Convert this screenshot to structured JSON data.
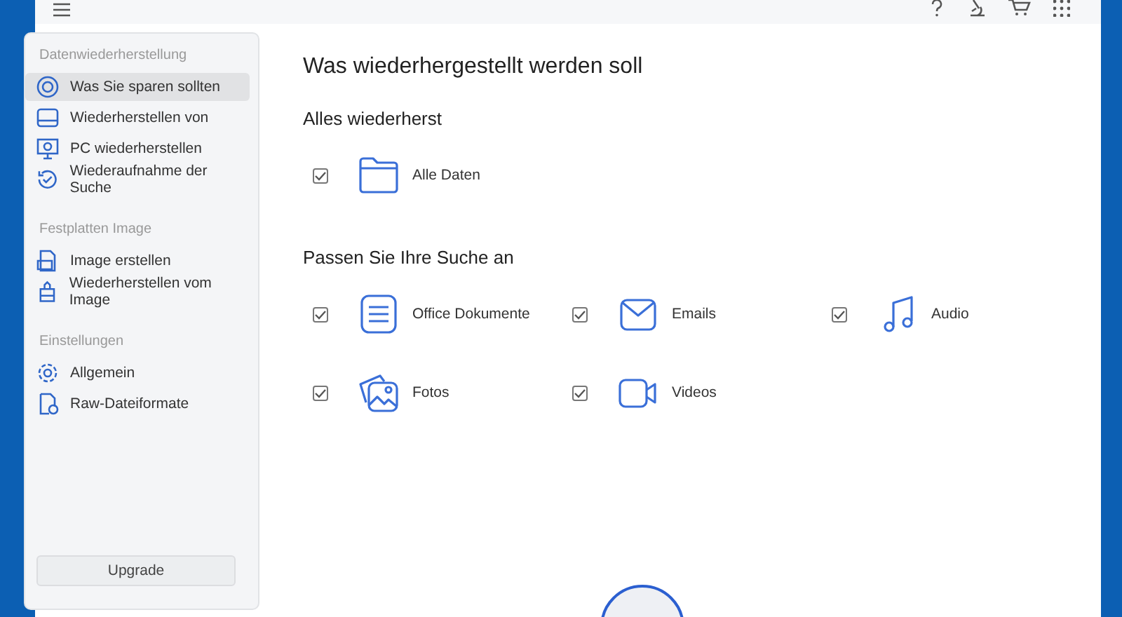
{
  "sidebar": {
    "sections": [
      {
        "heading": "Datenwiederherstellung",
        "items": [
          {
            "label": "Was Sie sparen sollten",
            "selected": true
          },
          {
            "label": "Wiederherstellen von",
            "selected": false
          },
          {
            "label": "PC wiederherstellen",
            "selected": false
          },
          {
            "label": "Wiederaufnahme der Suche",
            "selected": false
          }
        ]
      },
      {
        "heading": "Festplatten Image",
        "items": [
          {
            "label": "Image erstellen",
            "selected": false
          },
          {
            "label": "Wiederherstellen vom Image",
            "selected": false
          }
        ]
      },
      {
        "heading": "Einstellungen",
        "items": [
          {
            "label": "Allgemein",
            "selected": false
          },
          {
            "label": "Raw-Dateiformate",
            "selected": false
          }
        ]
      }
    ],
    "upgrade_button": "Upgrade"
  },
  "main": {
    "title": "Was wiederhergestellt werden soll",
    "groups": [
      {
        "heading": "Alles wiederherst",
        "options": [
          {
            "label": "Alle Daten",
            "checked": true
          }
        ]
      },
      {
        "heading": "Passen Sie Ihre Suche an",
        "options": [
          {
            "label": "Office Dokumente",
            "checked": true
          },
          {
            "label": "Emails",
            "checked": true
          },
          {
            "label": "Audio",
            "checked": true
          },
          {
            "label": "Fotos",
            "checked": true
          },
          {
            "label": "Videos",
            "checked": true
          }
        ]
      }
    ]
  }
}
